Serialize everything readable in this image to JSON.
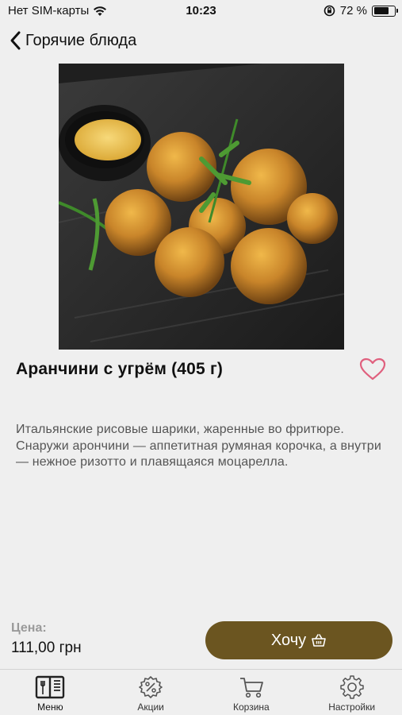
{
  "status_bar": {
    "carrier": "Нет SIM-карты",
    "time": "10:23",
    "battery_percent": "72 %",
    "battery_level": 0.72
  },
  "nav": {
    "back_label": "Горячие блюда"
  },
  "dish": {
    "title": "Аранчини с угрём (405 г)",
    "description": "Итальянские рисовые шарики, жаренные во фритюре. Снаружи арончини — аппетитная румяная корочка, а внутри — нежное ризотто и плавящаяся моцарелла.",
    "photo_icon": "dish-photo"
  },
  "price": {
    "label": "Цена:",
    "value": "111,00 грн"
  },
  "actions": {
    "want_label": "Хочу"
  },
  "tabs": [
    {
      "label": "Меню",
      "icon": "menu-book-icon",
      "active": true
    },
    {
      "label": "Акции",
      "icon": "discount-badge-icon",
      "active": false
    },
    {
      "label": "Корзина",
      "icon": "cart-icon",
      "active": false
    },
    {
      "label": "Настройки",
      "icon": "gear-icon",
      "active": false
    }
  ],
  "colors": {
    "background": "#efefef",
    "accent": "#6b5520",
    "favorite": "#e0607e"
  }
}
